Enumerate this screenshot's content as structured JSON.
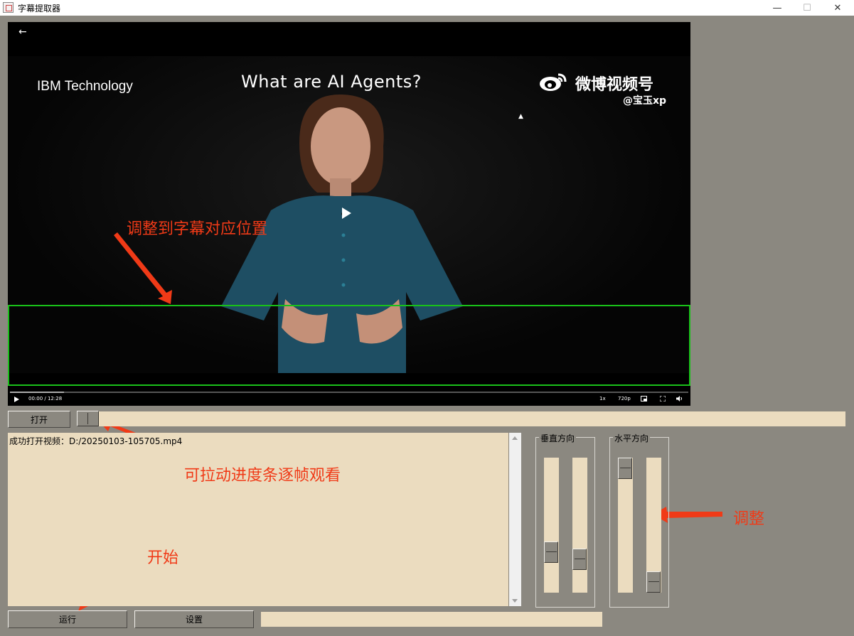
{
  "window": {
    "title": "字幕提取器",
    "minimize": "—",
    "maximize": "☐",
    "close": "✕"
  },
  "video": {
    "back_icon": "←",
    "channel": "IBM Technology",
    "title": "What are AI Agents?",
    "watermark_name": "微博视频号",
    "watermark_handle": "@宝玉xp",
    "time": "00:00 / 12:28",
    "speed": "1x",
    "quality": "720p",
    "progress": 0.08
  },
  "annotations": {
    "adjust_position": "调整到字幕对应位置",
    "drag_progress": "可拉动进度条逐帧观看",
    "adjust": "调整",
    "start": "开始"
  },
  "controls": {
    "open_label": "打开",
    "run_label": "运行",
    "settings_label": "设置",
    "vertical_group": "垂直方向",
    "horizontal_group": "水平方向"
  },
  "log": {
    "line1": "成功打开视频：D:/20250103-105705.mp4"
  },
  "colors": {
    "annotation": "#f03a17",
    "subtitle_box": "#19c119",
    "field_bg": "#ebdcbf",
    "window_bg": "#8b8880"
  }
}
